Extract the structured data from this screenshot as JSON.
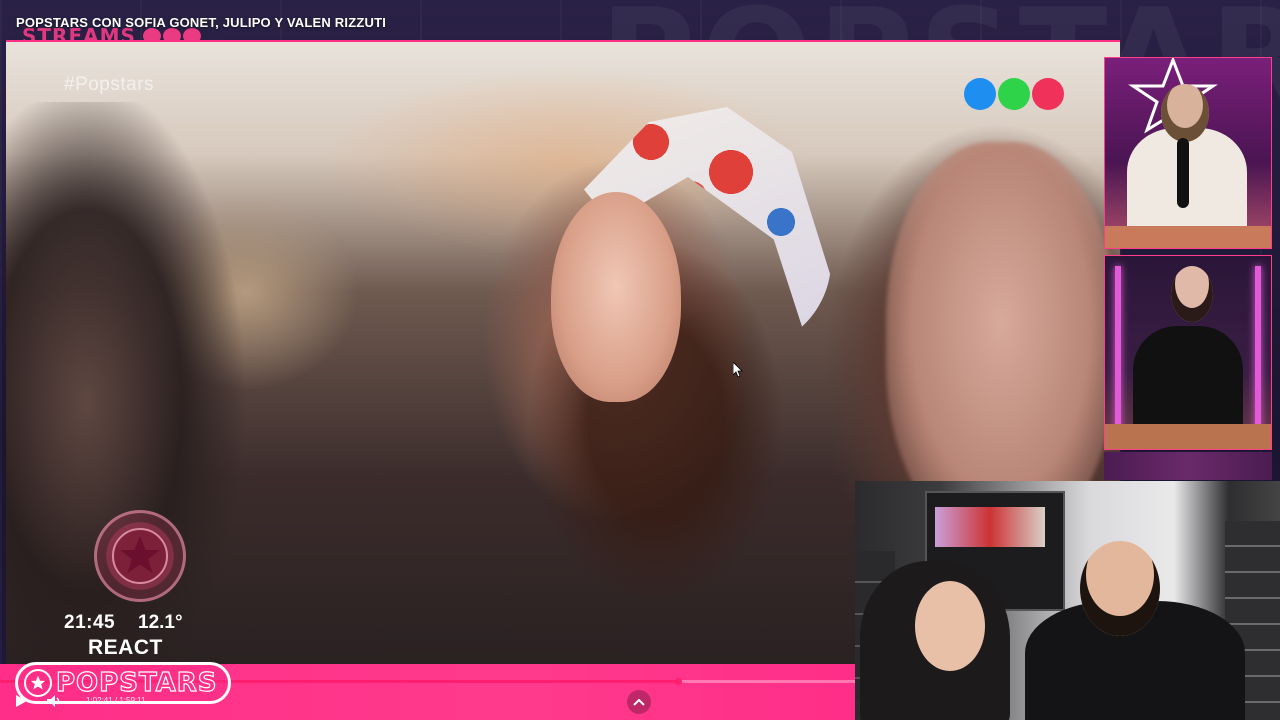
{
  "video": {
    "title": "POPSTARS CON SOFIA GONET, JULIPO Y VALEN RIZZUTI",
    "channel_logo": "STREAMS",
    "hashtag": "#Popstars"
  },
  "hud": {
    "time": "21:45",
    "temperature": "12.1°",
    "label": "REACT"
  },
  "brand": {
    "logo_text": "POPSTARS",
    "accent": "#ff2e88",
    "network_dot_colors": [
      "#1e8ef0",
      "#2fd34a",
      "#f0325a"
    ]
  },
  "player": {
    "time_display": "1:02:41 / 1:59:11",
    "progress": 0.793,
    "icons": {
      "play": "play-icon",
      "volume": "volume-icon",
      "expand": "chevron-up-icon"
    }
  }
}
